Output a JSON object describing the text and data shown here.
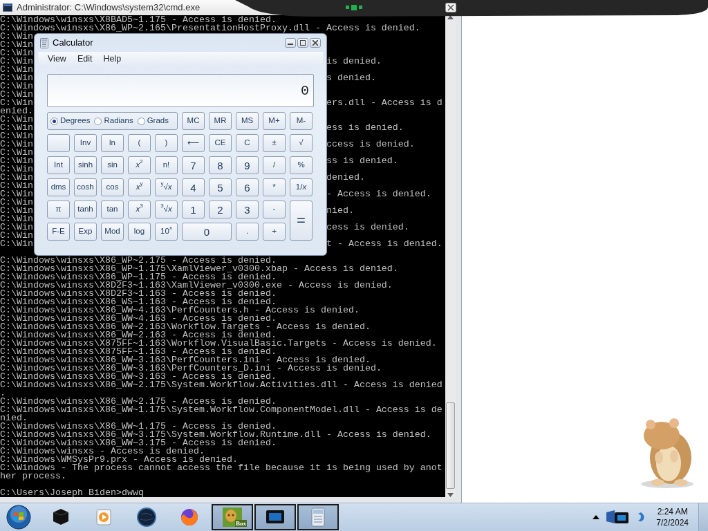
{
  "cmd_window": {
    "title": "Administrator: C:\\Windows\\system32\\cmd.exe",
    "lines": [
      {
        "text": "C:\\Windows\\winsxs\\X8BAD5~1.175 - Access is denied."
      },
      {
        "text": "C:\\Windows\\winsxs\\X86_WP~2.165\\PresentationHostProxy.dll - Access is denied."
      },
      {
        "left": "C:\\Win"
      },
      {
        "left": "C:\\Win"
      },
      {
        "left": "C:\\Win"
      },
      {
        "left": "C:\\Win",
        "right": "is denied."
      },
      {
        "left": "C:\\Win"
      },
      {
        "left": "C:\\Win",
        "right": "s denied."
      },
      {
        "left": "C:\\Win"
      },
      {
        "left": "C:\\Win"
      },
      {
        "left": "C:\\Win",
        "right": "ers.dll - Access is d"
      },
      {
        "left": "enied."
      },
      {
        "left": "C:\\Win"
      },
      {
        "left": "C:\\Win",
        "right": "ess is denied."
      },
      {
        "left": "C:\\Win"
      },
      {
        "left": "C:\\Win",
        "right": "ccess is denied."
      },
      {
        "left": "C:\\Win"
      },
      {
        "left": "C:\\Win",
        "right": "ss is denied."
      },
      {
        "left": "C:\\Win"
      },
      {
        "left": "C:\\Win",
        "right": "denied."
      },
      {
        "left": "C:\\Win"
      },
      {
        "left": "C:\\Win",
        "right": "- Access is denied."
      },
      {
        "left": "C:\\Win"
      },
      {
        "left": "C:\\Win",
        "right": "nied."
      },
      {
        "left": "C:\\Win"
      },
      {
        "left": "C:\\Win",
        "right": "cess is denied."
      },
      {
        "left": "C:\\Win"
      },
      {
        "left": "C:\\Win",
        "right": "t - Access is denied."
      },
      {
        "kind": "blank"
      },
      {
        "text": "C:\\Windows\\winsxs\\X86_WP~2.175 - Access is denied."
      },
      {
        "text": "C:\\Windows\\winsxs\\X86_WP~1.175\\XamlViewer_v0300.xbap - Access is denied."
      },
      {
        "text": "C:\\Windows\\winsxs\\X86_WP~1.175 - Access is denied."
      },
      {
        "text": "C:\\Windows\\winsxs\\X8D2F3~1.163\\XamlViewer_v0300.exe - Access is denied."
      },
      {
        "text": "C:\\Windows\\winsxs\\X8D2F3~1.163 - Access is denied."
      },
      {
        "text": "C:\\Windows\\winsxs\\X86_WS~1.163 - Access is denied."
      },
      {
        "text": "C:\\Windows\\winsxs\\X86_WW~4.163\\PerfCounters.h - Access is denied."
      },
      {
        "text": "C:\\Windows\\winsxs\\X86_WW~4.163 - Access is denied."
      },
      {
        "text": "C:\\Windows\\winsxs\\X86_WW~2.163\\Workflow.Targets - Access is denied."
      },
      {
        "text": "C:\\Windows\\winsxs\\X86_WW~2.163 - Access is denied."
      },
      {
        "text": "C:\\Windows\\winsxs\\X875FF~1.163\\Workflow.VisualBasic.Targets - Access is denied."
      },
      {
        "text": "C:\\Windows\\winsxs\\X875FF~1.163 - Access is denied."
      },
      {
        "text": "C:\\Windows\\winsxs\\X86_WW~3.163\\PerfCounters.ini - Access is denied."
      },
      {
        "text": "C:\\Windows\\winsxs\\X86_WW~3.163\\PerfCounters_D.ini - Access is denied."
      },
      {
        "text": "C:\\Windows\\winsxs\\X86_WW~3.163 - Access is denied."
      },
      {
        "text": "C:\\Windows\\winsxs\\X86_WW~2.175\\System.Workflow.Activities.dll - Access is denied"
      },
      {
        "text": "."
      },
      {
        "text": "C:\\Windows\\winsxs\\X86_WW~2.175 - Access is denied."
      },
      {
        "text": "C:\\Windows\\winsxs\\X86_WW~1.175\\System.Workflow.ComponentModel.dll - Access is de"
      },
      {
        "text": "nied."
      },
      {
        "text": "C:\\Windows\\winsxs\\X86_WW~1.175 - Access is denied."
      },
      {
        "text": "C:\\Windows\\winsxs\\X86_WW~3.175\\System.Workflow.Runtime.dll - Access is denied."
      },
      {
        "text": "C:\\Windows\\winsxs\\X86_WW~3.175 - Access is denied."
      },
      {
        "text": "C:\\Windows\\winsxs - Access is denied."
      },
      {
        "text": "C:\\Windows\\WMSysPr9.prx - Access is denied."
      },
      {
        "text": "C:\\Windows - The process cannot access the file because it is being used by anot"
      },
      {
        "text": "her process."
      },
      {
        "kind": "blank"
      },
      {
        "text": "C:\\Users\\Joseph Biden>dwwq"
      }
    ]
  },
  "calculator": {
    "title": "Calculator",
    "menu": [
      "View",
      "Edit",
      "Help"
    ],
    "display": "0",
    "angle_units": [
      {
        "label": "Degrees",
        "selected": true
      },
      {
        "label": "Radians",
        "selected": false
      },
      {
        "label": "Grads",
        "selected": false
      }
    ],
    "keys": [
      {
        "label": "MC"
      },
      {
        "label": "MR"
      },
      {
        "label": "MS"
      },
      {
        "label": "M+"
      },
      {
        "label": "M-"
      },
      {
        "kind": "blank"
      },
      {
        "label": "Inv"
      },
      {
        "label": "ln"
      },
      {
        "label": "("
      },
      {
        "label": ")"
      },
      {
        "label": "⟵"
      },
      {
        "label": "CE"
      },
      {
        "label": "C"
      },
      {
        "label": "±"
      },
      {
        "label": "√"
      },
      {
        "label": "Int"
      },
      {
        "label": "sinh"
      },
      {
        "label": "sin"
      },
      {
        "label": "*x*$^{2}$"
      },
      {
        "label": "n!"
      },
      {
        "label": "7"
      },
      {
        "label": "8"
      },
      {
        "label": "9"
      },
      {
        "label": "/"
      },
      {
        "label": "%"
      },
      {
        "label": "dms"
      },
      {
        "label": "cosh"
      },
      {
        "label": "cos"
      },
      {
        "label": "*x*$^{y}$"
      },
      {
        "label": "$^{y}$√*x*"
      },
      {
        "label": "4"
      },
      {
        "label": "5"
      },
      {
        "label": "6"
      },
      {
        "label": "*"
      },
      {
        "label": "1/*x*"
      },
      {
        "label": "π"
      },
      {
        "label": "tanh"
      },
      {
        "label": "tan"
      },
      {
        "label": "*x*$^{3}$"
      },
      {
        "label": "$^{3}$√*x*"
      },
      {
        "label": "1"
      },
      {
        "label": "2"
      },
      {
        "label": "3"
      },
      {
        "label": "-"
      },
      {
        "label": "=",
        "kind": "tall"
      },
      {
        "label": "F-E"
      },
      {
        "label": "Exp"
      },
      {
        "label": "Mod"
      },
      {
        "label": "log"
      },
      {
        "label": "10$^{x}$"
      },
      {
        "label": "0",
        "kind": "wide"
      },
      {
        "label": "."
      },
      {
        "label": "+"
      }
    ]
  },
  "taskbar": {
    "apps": [
      {
        "kind": "cube",
        "running": false
      },
      {
        "kind": "media",
        "running": false
      },
      {
        "kind": "globe",
        "running": false
      },
      {
        "kind": "browser",
        "running": false
      },
      {
        "kind": "game",
        "running": true,
        "label": "Box"
      },
      {
        "kind": "monitor",
        "running": true
      },
      {
        "kind": "calculator",
        "running": true
      }
    ],
    "clock": {
      "time": "2:24 AM",
      "date": "7/2/2024"
    }
  }
}
